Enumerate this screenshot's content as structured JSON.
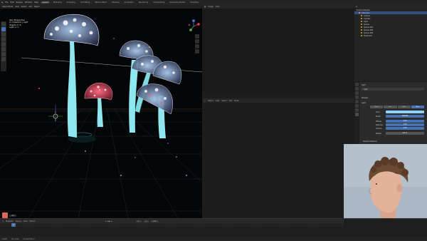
{
  "menu": {
    "items": [
      "File",
      "Edit",
      "Render",
      "Window",
      "Help"
    ],
    "workspaces": [
      "Layout",
      "Modeling",
      "Sculpting",
      "UV Editing",
      "Texture Paint",
      "Shading",
      "Animation",
      "Rendering",
      "Compositing",
      "Geometry Nodes",
      "Scripting"
    ],
    "active_workspace": "Layout"
  },
  "viewport": {
    "header": [
      "Object Mode",
      "View",
      "Select",
      "Add",
      "Object"
    ],
    "info_line1": "User Perspective",
    "info_line2": "(1) Collection | Light",
    "info_line3": "Objects   1 / 9",
    "info_line4": "Light   1 / 1",
    "bottom_label": "Ref"
  },
  "top_editor": {
    "header": [
      "Image",
      "View"
    ]
  },
  "mid_editor": {
    "header": [
      "Object",
      "View",
      "Select",
      "Add",
      "Node"
    ]
  },
  "outliner": {
    "title": "Scene Collection",
    "items": [
      "Collection",
      "Camera",
      "Cylinder",
      "Light",
      "Sphere",
      "Sphere.001",
      "Sphere.002",
      "Sphere.003",
      "Mushroom"
    ]
  },
  "properties": {
    "object_name": "Light",
    "tabs": [
      "Point",
      "Sun",
      "Spot",
      "Area"
    ],
    "rows": [
      {
        "label": "Preview",
        "value": ""
      },
      {
        "label": "Light",
        "value": ""
      },
      {
        "label": "Color",
        "value": ""
      },
      {
        "label": "Power",
        "value": "1000 W"
      },
      {
        "label": "Diffuse",
        "value": "1.00"
      },
      {
        "label": "Specular",
        "value": "1.00"
      },
      {
        "label": "Volume",
        "value": "1.00"
      },
      {
        "label": "Radius",
        "value": "0.1 m"
      }
    ],
    "section": "Custom Distance"
  },
  "timeline": {
    "header": [
      "Playback",
      "Keying",
      "View",
      "Marker"
    ],
    "current_frame": "1",
    "start": "1",
    "end": "250"
  },
  "status": {
    "items": [
      "Select",
      "Pan View",
      "Context Menu"
    ]
  },
  "colors": {
    "accent": "#4772b3",
    "mushroom_stem": "#8ee6ee",
    "mushroom_red": "#d8435a"
  }
}
